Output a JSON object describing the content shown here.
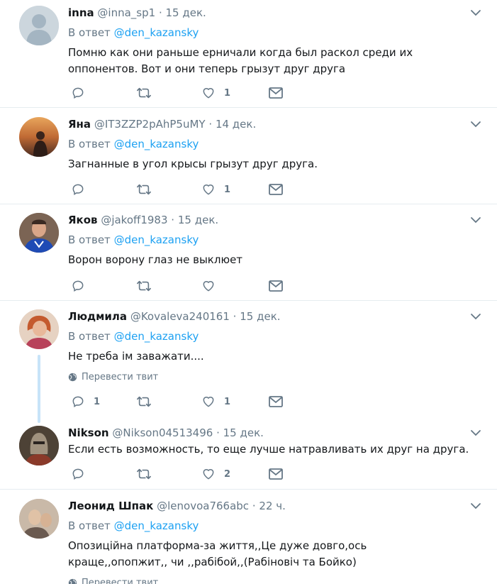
{
  "reply_prefix": "В ответ",
  "translate_label": "Перевести твит",
  "tweets": [
    {
      "name": "inna",
      "handle": "@inna_sp1",
      "time": "15 дек.",
      "reply_to": "@den_kazansky",
      "text": "Помню как они раньше ерничали когда был раскол среди их оппонентов. Вот и они теперь грызут друг друга",
      "replies": "",
      "retweets": "",
      "likes": "1"
    },
    {
      "name": "Яна",
      "handle": "@IT3ZZP2pAhP5uMY",
      "time": "14 дек.",
      "reply_to": "@den_kazansky",
      "text": "Загнанные в угол крысы грызут друг друга.",
      "replies": "",
      "retweets": "",
      "likes": "1"
    },
    {
      "name": "Яков",
      "handle": "@jakoff1983",
      "time": "15 дек.",
      "reply_to": "@den_kazansky",
      "text": "Ворон ворону глаз не выклюет",
      "replies": "",
      "retweets": "",
      "likes": ""
    },
    {
      "name": "Людмила",
      "handle": "@Kovaleva240161",
      "time": "15 дек.",
      "reply_to": "@den_kazansky",
      "text": "Не треба ім заважати....",
      "replies": "1",
      "retweets": "",
      "likes": "1"
    },
    {
      "name": "Nikson",
      "handle": "@Nikson04513496",
      "time": "15 дек.",
      "reply_to": "",
      "text": "Если есть возможность, то еще лучше натравливать их друг на друга.",
      "replies": "",
      "retweets": "",
      "likes": "2"
    },
    {
      "name": "Леонид Шпак",
      "handle": "@lenovoa766abc",
      "time": "22 ч.",
      "reply_to": "@den_kazansky",
      "text": "Опозиційна платформа-за життя,,Це дуже довго,ось краще,,опопжит,, чи ,,рабібой,,(Рабіновіч та Бойко)",
      "replies": "",
      "retweets": "",
      "likes": ""
    }
  ]
}
